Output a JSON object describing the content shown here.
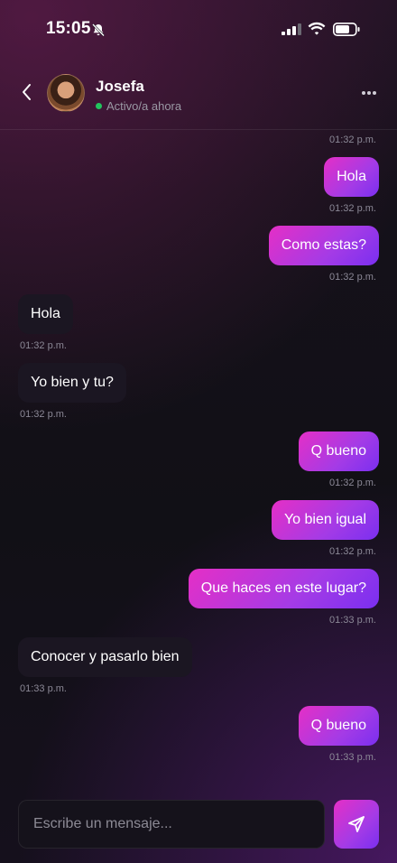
{
  "status_bar": {
    "time": "15:05"
  },
  "header": {
    "contact_name": "Josefa",
    "presence": "Activo/a ahora"
  },
  "messages": [
    {
      "direction": "out",
      "time": "01:32 p.m.",
      "text": "Hola",
      "time_below": "01:32 p.m."
    },
    {
      "direction": "out",
      "text": "Como estas?",
      "time": "01:32 p.m."
    },
    {
      "direction": "in",
      "text": "Hola",
      "time": "01:32 p.m."
    },
    {
      "direction": "in",
      "text": "Yo bien y tu?",
      "time": "01:32 p.m."
    },
    {
      "direction": "out",
      "text": "Q bueno",
      "time": "01:32 p.m."
    },
    {
      "direction": "out",
      "text": "Yo bien igual",
      "time": "01:32 p.m."
    },
    {
      "direction": "out",
      "text": "Que haces en este lugar?",
      "time": "01:33 p.m."
    },
    {
      "direction": "in",
      "text": "Conocer y pasarlo bien",
      "time": "01:33 p.m."
    },
    {
      "direction": "out",
      "text": "Q bueno",
      "time": "01:33 p.m."
    }
  ],
  "top_timestamp": "01:32 p.m.",
  "composer": {
    "placeholder": "Escribe un mensaje..."
  },
  "colors": {
    "accent_start": "#e52fc6",
    "accent_end": "#7a2ff0",
    "online": "#22c55e",
    "incoming_bubble": "#1b1622"
  }
}
